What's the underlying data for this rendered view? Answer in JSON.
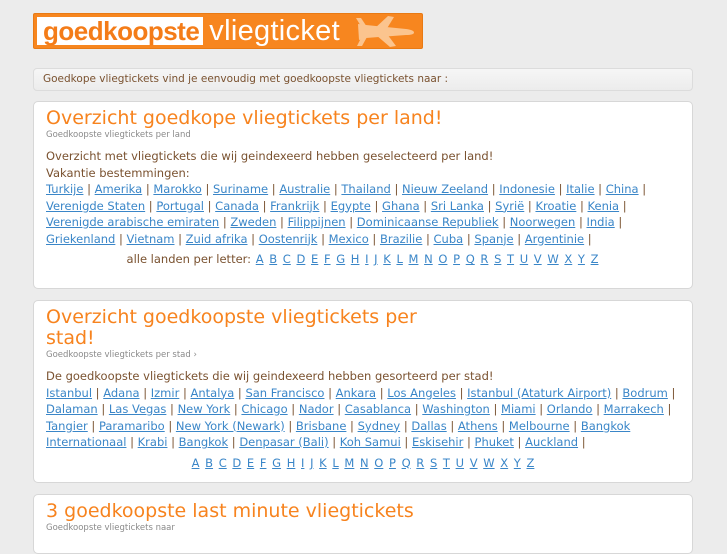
{
  "logo": {
    "left_text": "goedkoopste",
    "right_text": "vliegticket",
    "icon": "airplane-icon",
    "colors": {
      "orange": "#f7861f",
      "plane": "#fbc48e"
    }
  },
  "intro": {
    "text": "Goedkope vliegtickets vind je eenvoudig met goedkoopste vliegtickets naar :"
  },
  "countries": {
    "title": "Overzicht goedkope vliegtickets per land!",
    "subtitle": "Goedkoopste vliegtickets per land",
    "description": "Overzicht met vliegtickets die wij geindexeerd hebben geselecteerd per land!",
    "label": "Vakantie bestemmingen:",
    "items": [
      "Turkije",
      "Amerika",
      "Marokko",
      "Suriname",
      "Australie",
      "Thailand",
      "Nieuw Zeeland",
      "Indonesie",
      "Italie",
      "China",
      "Verenigde Staten",
      "Portugal",
      "Canada",
      "Frankrijk",
      "Egypte",
      "Ghana",
      "Sri Lanka",
      "Syrië",
      "Kroatie",
      "Kenia",
      "Verenigde arabische emiraten",
      "Zweden",
      "Filippijnen",
      "Dominicaanse Republiek",
      "Noorwegen",
      "India",
      "Griekenland",
      "Vietnam",
      "Zuid afrika",
      "Oostenrijk",
      "Mexico",
      "Brazilie",
      "Cuba",
      "Spanje",
      "Argentinie"
    ],
    "letters_label": "alle landen per letter:",
    "letters": [
      "A",
      "B",
      "C",
      "D",
      "E",
      "F",
      "G",
      "H",
      "I",
      "J",
      "K",
      "L",
      "M",
      "N",
      "O",
      "P",
      "Q",
      "R",
      "S",
      "T",
      "U",
      "V",
      "W",
      "X",
      "Y",
      "Z"
    ]
  },
  "cities": {
    "title": "Overzicht goedkoopste vliegtickets per stad!",
    "subtitle": "Goedkoopste vliegtickets per stad ›",
    "description": "De goedkoopste vliegtickets die wij geindexeerd hebben gesorteerd per stad!",
    "items": [
      "Istanbul",
      "Adana",
      "Izmir",
      "Antalya",
      "San Francisco",
      "Ankara",
      "Los Angeles",
      "Istanbul (Ataturk Airport)",
      "Bodrum",
      "Dalaman",
      "Las Vegas",
      "New York",
      "Chicago",
      "Nador",
      "Casablanca",
      "Washington",
      "Miami",
      "Orlando",
      "Marrakech",
      "Tangier",
      "Paramaribo",
      "New York (Newark)",
      "Brisbane",
      "Sydney",
      "Dallas",
      "Athens",
      "Melbourne",
      "Bangkok Internationaal",
      "Krabi",
      "Bangkok",
      "Denpasar (Bali)",
      "Koh Samui",
      "Eskisehir",
      "Phuket",
      "Auckland"
    ],
    "letters": [
      "A",
      "B",
      "C",
      "D",
      "E",
      "F",
      "G",
      "H",
      "I",
      "J",
      "K",
      "L",
      "M",
      "N",
      "O",
      "P",
      "Q",
      "R",
      "S",
      "T",
      "U",
      "V",
      "W",
      "X",
      "Y",
      "Z"
    ]
  },
  "lastminute": {
    "title": "3 goedkoopste last minute vliegtickets",
    "subtitle": "Goedkoopste vliegtickets naar"
  },
  "colors": {
    "title": "#f7831e",
    "body_text": "#7a5230",
    "link": "#3a86c8",
    "subtitle": "#8a8a8a",
    "background": "#ececec"
  }
}
